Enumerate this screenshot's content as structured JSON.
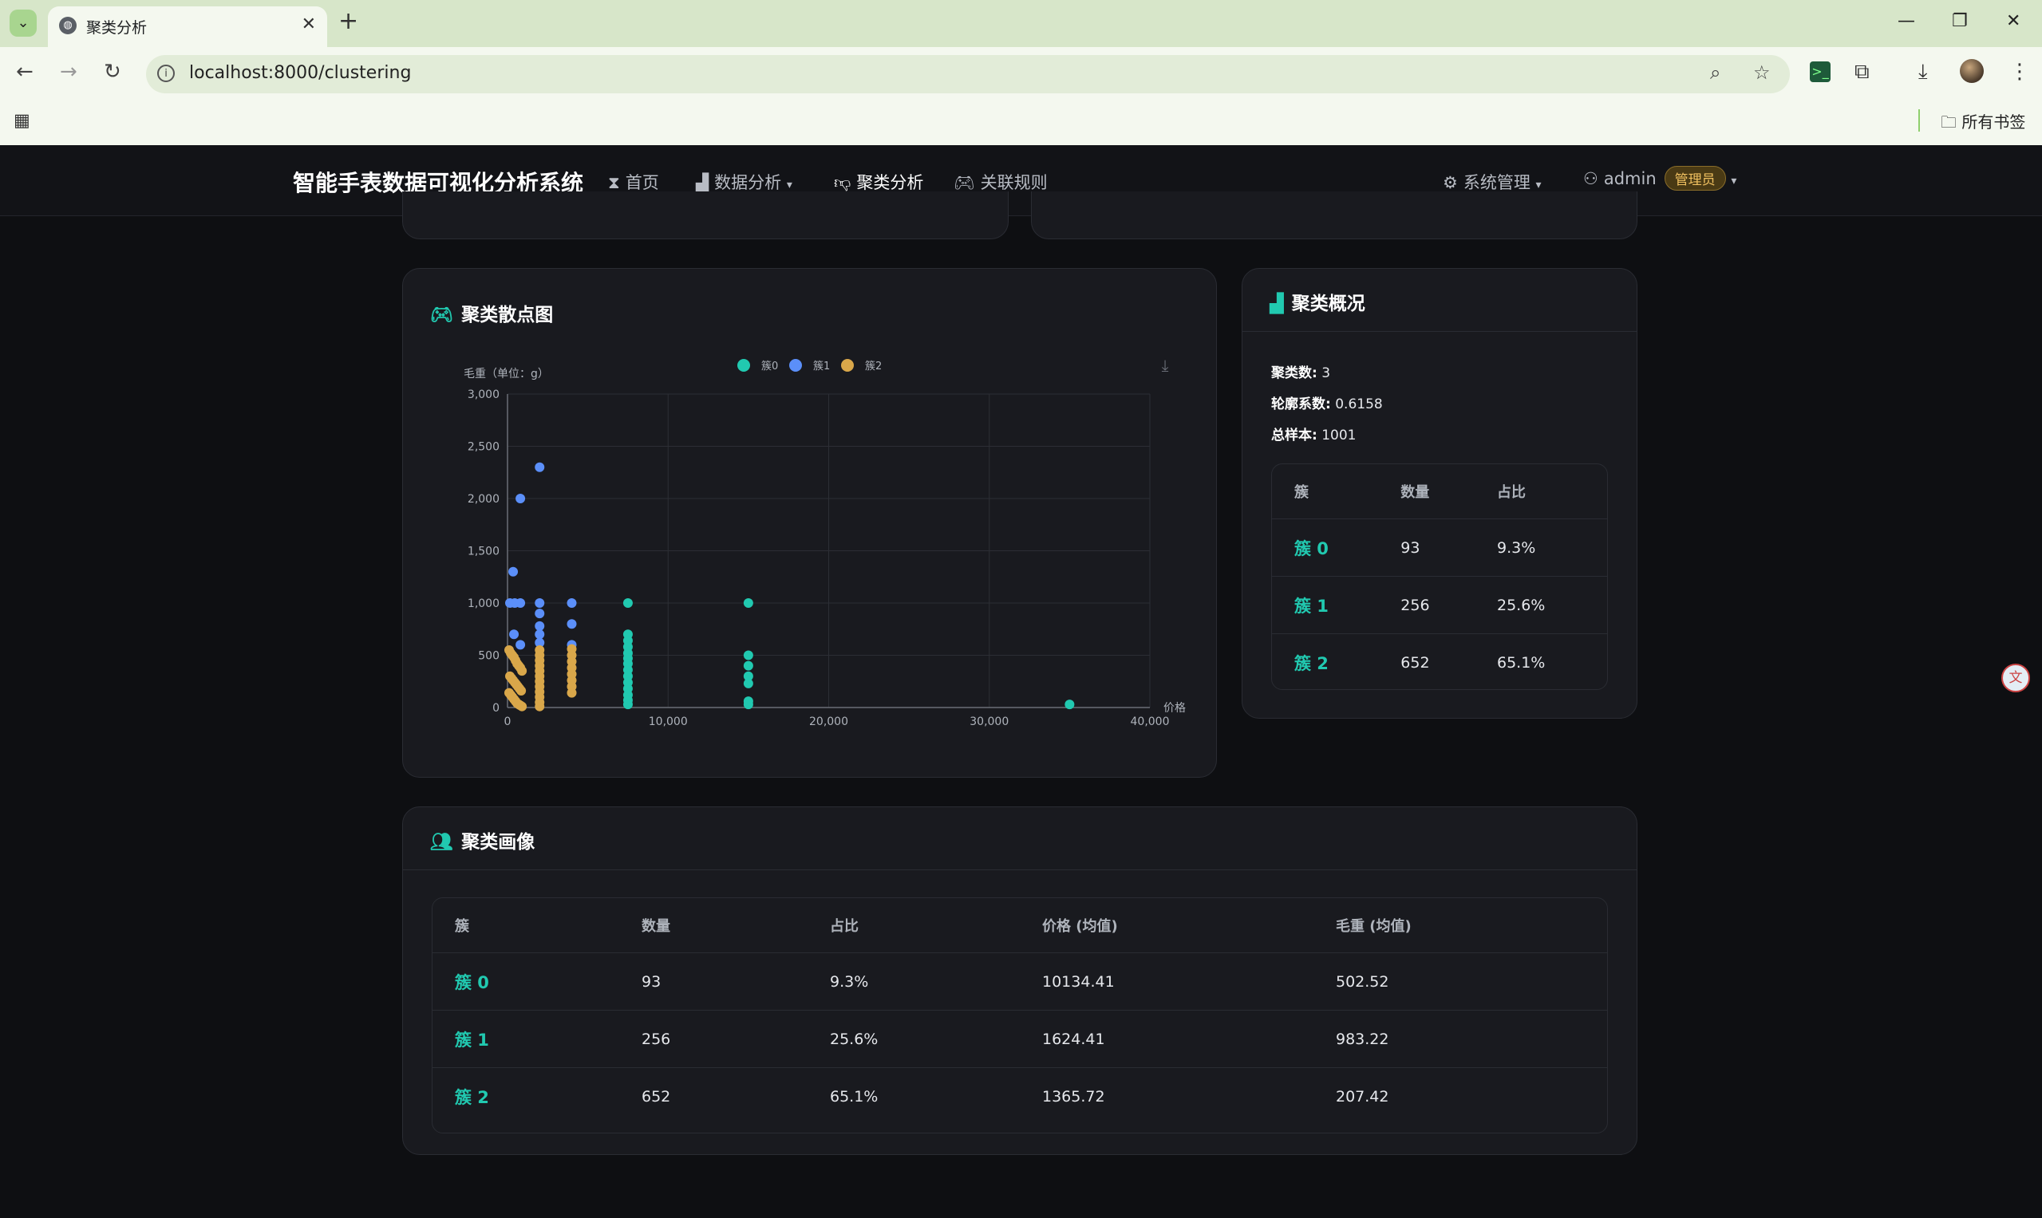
{
  "browser": {
    "tab_title": "聚类分析",
    "url": "localhost:8000/clustering",
    "bookmarks_folder": "所有书签"
  },
  "navbar": {
    "brand": "智能手表数据可视化分析系统",
    "items": [
      {
        "label": "首页",
        "icon": "hourglass-icon"
      },
      {
        "label": "数据分析",
        "icon": "bar-chart-icon"
      },
      {
        "label": "聚类分析",
        "icon": "thumbs-down-icon"
      },
      {
        "label": "关联规则",
        "icon": "gamepad-icon"
      }
    ],
    "system": "系统管理",
    "user": "admin",
    "role": "管理员"
  },
  "scatter_card": {
    "title": "聚类散点图"
  },
  "chart_data": {
    "type": "scatter",
    "ylabel": "毛重（单位：g）",
    "xlabel": "价格",
    "xlim": [
      0,
      40000
    ],
    "ylim": [
      0,
      3000
    ],
    "xticks": [
      "0",
      "10,000",
      "20,000",
      "30,000",
      "40,000"
    ],
    "yticks": [
      "0",
      "500",
      "1,000",
      "1,500",
      "2,000",
      "2,500",
      "3,000"
    ],
    "legend_position": "top-center",
    "grid": true,
    "series": [
      {
        "name": "簇0",
        "color": "#21c9b0",
        "points": [
          [
            7500,
            1000
          ],
          [
            7500,
            700
          ],
          [
            7500,
            640
          ],
          [
            7500,
            580
          ],
          [
            7500,
            520
          ],
          [
            7500,
            470
          ],
          [
            7500,
            420
          ],
          [
            7500,
            360
          ],
          [
            7500,
            300
          ],
          [
            7500,
            240
          ],
          [
            7500,
            180
          ],
          [
            7500,
            120
          ],
          [
            7500,
            70
          ],
          [
            7500,
            30
          ],
          [
            15000,
            1000
          ],
          [
            15000,
            500
          ],
          [
            15000,
            400
          ],
          [
            15000,
            300
          ],
          [
            15000,
            230
          ],
          [
            15000,
            60
          ],
          [
            15000,
            30
          ],
          [
            35000,
            30
          ]
        ]
      },
      {
        "name": "簇1",
        "color": "#5b8ff9",
        "points": [
          [
            2000,
            2300
          ],
          [
            800,
            2000
          ],
          [
            350,
            1300
          ],
          [
            150,
            1000
          ],
          [
            450,
            1000
          ],
          [
            800,
            1000
          ],
          [
            2000,
            1000
          ],
          [
            2000,
            900
          ],
          [
            2000,
            780
          ],
          [
            2000,
            700
          ],
          [
            2000,
            620
          ],
          [
            4000,
            1000
          ],
          [
            4000,
            800
          ],
          [
            4000,
            600
          ],
          [
            800,
            600
          ],
          [
            400,
            700
          ]
        ]
      },
      {
        "name": "簇2",
        "color": "#d9a74a",
        "points": [
          [
            100,
            550
          ],
          [
            200,
            520
          ],
          [
            300,
            500
          ],
          [
            400,
            480
          ],
          [
            500,
            450
          ],
          [
            600,
            420
          ],
          [
            700,
            400
          ],
          [
            800,
            380
          ],
          [
            900,
            350
          ],
          [
            150,
            300
          ],
          [
            250,
            280
          ],
          [
            350,
            260
          ],
          [
            450,
            240
          ],
          [
            550,
            220
          ],
          [
            650,
            200
          ],
          [
            750,
            180
          ],
          [
            850,
            160
          ],
          [
            100,
            140
          ],
          [
            200,
            120
          ],
          [
            300,
            100
          ],
          [
            400,
            80
          ],
          [
            500,
            60
          ],
          [
            600,
            40
          ],
          [
            700,
            30
          ],
          [
            800,
            20
          ],
          [
            900,
            10
          ],
          [
            2000,
            550
          ],
          [
            2000,
            500
          ],
          [
            2000,
            450
          ],
          [
            2000,
            400
          ],
          [
            2000,
            350
          ],
          [
            2000,
            300
          ],
          [
            2000,
            250
          ],
          [
            2000,
            200
          ],
          [
            2000,
            150
          ],
          [
            2000,
            100
          ],
          [
            2000,
            50
          ],
          [
            2000,
            10
          ],
          [
            4000,
            560
          ],
          [
            4000,
            500
          ],
          [
            4000,
            440
          ],
          [
            4000,
            380
          ],
          [
            4000,
            320
          ],
          [
            4000,
            260
          ],
          [
            4000,
            200
          ],
          [
            4000,
            140
          ]
        ]
      }
    ]
  },
  "overview_card": {
    "title": "聚类概况",
    "clusters_label": "聚类数:",
    "clusters_value": "3",
    "silhouette_label": "轮廓系数:",
    "silhouette_value": "0.6158",
    "samples_label": "总样本:",
    "samples_value": "1001",
    "headers": [
      "簇",
      "数量",
      "占比"
    ],
    "rows": [
      {
        "cluster": "簇 0",
        "count": "93",
        "ratio": "9.3%"
      },
      {
        "cluster": "簇 1",
        "count": "256",
        "ratio": "25.6%"
      },
      {
        "cluster": "簇 2",
        "count": "652",
        "ratio": "65.1%"
      }
    ]
  },
  "profile_card": {
    "title": "聚类画像",
    "headers": [
      "簇",
      "数量",
      "占比",
      "价格 (均值)",
      "毛重 (均值)"
    ],
    "rows": [
      {
        "cluster": "簇 0",
        "count": "93",
        "ratio": "9.3%",
        "price": "10134.41",
        "weight": "502.52"
      },
      {
        "cluster": "簇 1",
        "count": "256",
        "ratio": "25.6%",
        "price": "1624.41",
        "weight": "983.22"
      },
      {
        "cluster": "簇 2",
        "count": "652",
        "ratio": "65.1%",
        "price": "1365.72",
        "weight": "207.42"
      }
    ]
  }
}
